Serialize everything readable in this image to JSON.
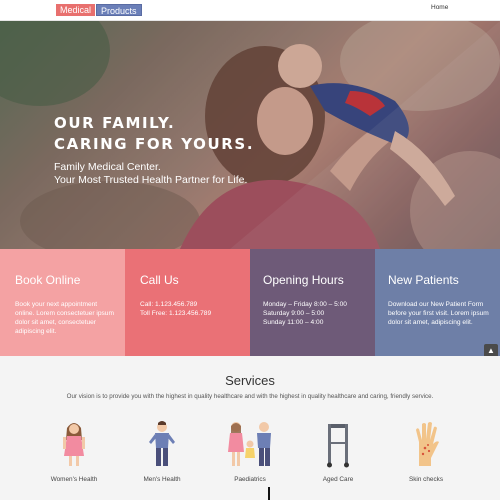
{
  "header": {
    "logo_part1": "Medical",
    "logo_part2": "Products",
    "nav_home": "Home"
  },
  "hero": {
    "title_line1": "OUR FAMILY.",
    "title_line2": "CARING FOR YOURS.",
    "subtitle_line1": "Family Medical Center.",
    "subtitle_line2": "Your Most Trusted Health Partner for Life."
  },
  "info_boxes": [
    {
      "title": "Book Online",
      "text": "Book your next appointment online. Lorem consectetuer ipsum dolor sit amet, consectetuer adipiscing elit.",
      "color": "#f4a2a3"
    },
    {
      "title": "Call Us",
      "text": "Call: 1.123.456.789\nToll Free: 1.123.456.789",
      "color": "#ea7176"
    },
    {
      "title": "Opening Hours",
      "text": "Monday – Friday 8:00 – 5:00\nSaturday 9:00 – 5:00\nSunday 11:00 – 4:00",
      "color": "#6e5a78"
    },
    {
      "title": "New Patients",
      "text": "Download our New Patient Form before your first visit. Lorem ipsum dolor sit amet, adipiscing elit.",
      "color": "#6e7fa7"
    }
  ],
  "scroll_top_icon": "chevron-up-icon",
  "services": {
    "title": "Services",
    "intro": "Our vision is to provide you with the highest in quality healthcare and with the highest in quality healthcare and caring, friendly service.",
    "items": [
      {
        "label": "Women's Health",
        "icon": "woman-icon"
      },
      {
        "label": "Men's Health",
        "icon": "man-icon"
      },
      {
        "label": "Paediatrics",
        "icon": "family-icon"
      },
      {
        "label": "Aged Care",
        "icon": "walker-icon"
      },
      {
        "label": "Skin checks",
        "icon": "hand-icon"
      }
    ]
  }
}
